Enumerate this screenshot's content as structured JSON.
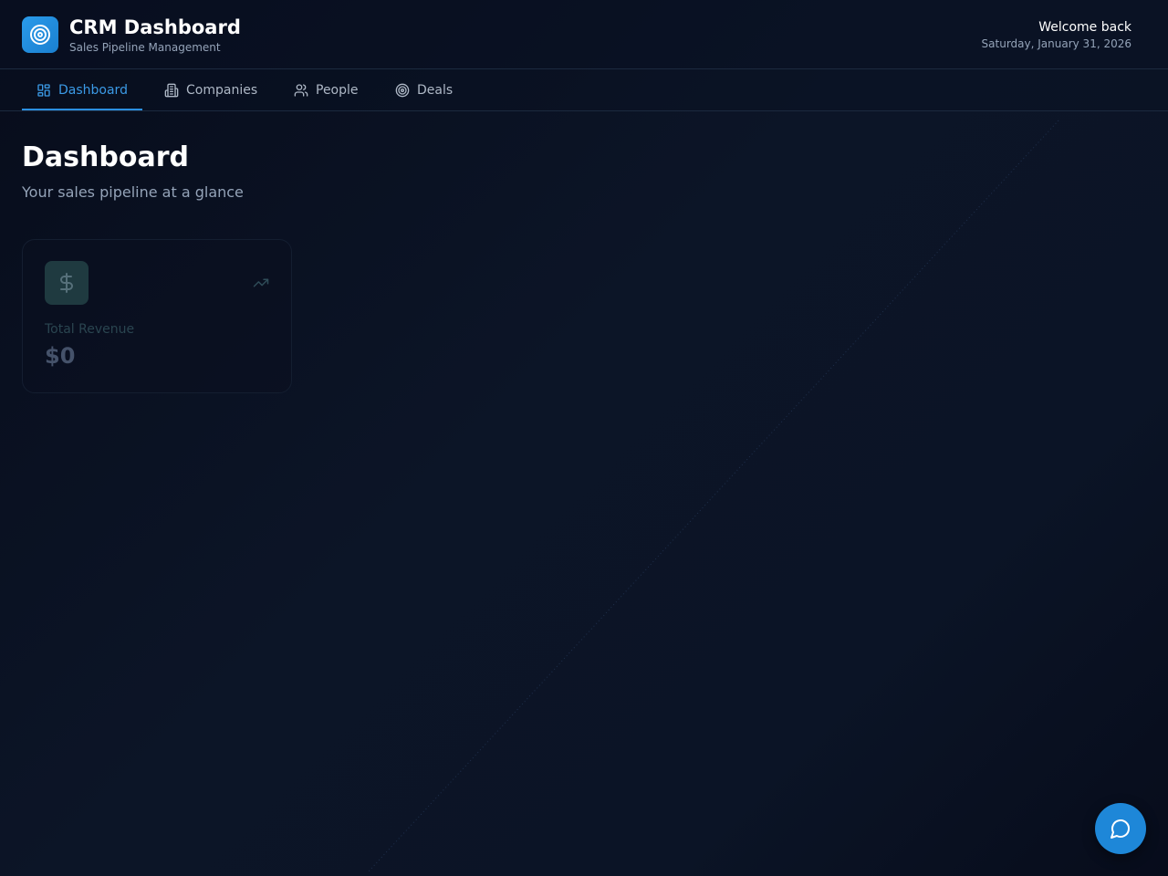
{
  "header": {
    "app_title": "CRM Dashboard",
    "app_subtitle": "Sales Pipeline Management",
    "welcome_text": "Welcome back",
    "date_text": "Saturday, January 31, 2026",
    "logo_icon": "target-icon"
  },
  "nav": {
    "tabs": [
      {
        "label": "Dashboard",
        "icon": "dashboard-grid-icon",
        "active": true
      },
      {
        "label": "Companies",
        "icon": "building-icon",
        "active": false
      },
      {
        "label": "People",
        "icon": "users-icon",
        "active": false
      },
      {
        "label": "Deals",
        "icon": "target-icon",
        "active": false
      }
    ]
  },
  "main": {
    "title": "Dashboard",
    "subtitle": "Your sales pipeline at a glance",
    "stat_cards": [
      {
        "label": "Total Revenue",
        "value": "$0",
        "icon": "dollar-icon",
        "trend_icon": "trending-up-icon"
      }
    ]
  },
  "chat_button": {
    "icon": "chat-bubble-icon"
  },
  "colors": {
    "accent": "#2b8fe0",
    "background": "#0b1426",
    "text_primary": "#ffffff",
    "text_secondary": "#94a3b8"
  }
}
